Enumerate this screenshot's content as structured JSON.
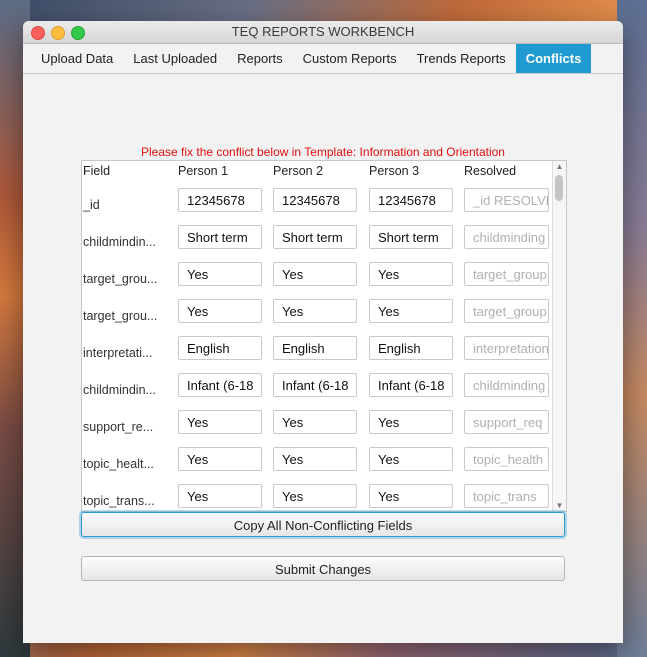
{
  "window": {
    "title": "TEQ REPORTS WORKBENCH"
  },
  "tabs": [
    {
      "label": "Upload Data"
    },
    {
      "label": "Last Uploaded"
    },
    {
      "label": "Reports"
    },
    {
      "label": "Custom Reports"
    },
    {
      "label": "Trends Reports"
    },
    {
      "label": "Conflicts"
    }
  ],
  "message": "Please fix the conflict below in Template: Information and Orientation",
  "grid": {
    "headers": [
      "Field",
      "Person 1",
      "Person 2",
      "Person 3",
      "Resolved"
    ],
    "rows": [
      {
        "field": "_id",
        "p1": "12345678",
        "p2": "12345678",
        "p3": "12345678",
        "resolved": "_id RESOLVED"
      },
      {
        "field": "childmindin...",
        "p1": "Short term",
        "p2": "Short term",
        "p3": "Short term",
        "resolved": "childminding"
      },
      {
        "field": "target_grou...",
        "p1": "Yes",
        "p2": "Yes",
        "p3": "Yes",
        "resolved": "target_group"
      },
      {
        "field": "target_grou...",
        "p1": "Yes",
        "p2": "Yes",
        "p3": "Yes",
        "resolved": "target_group"
      },
      {
        "field": "interpretati...",
        "p1": "English",
        "p2": "English",
        "p3": "English",
        "resolved": "interpretation"
      },
      {
        "field": "childmindin...",
        "p1": "Infant (6-18",
        "p2": "Infant (6-18",
        "p3": "Infant (6-18",
        "resolved": "childminding"
      },
      {
        "field": "support_re...",
        "p1": "Yes",
        "p2": "Yes",
        "p3": "Yes",
        "resolved": "support_req"
      },
      {
        "field": "topic_healt...",
        "p1": "Yes",
        "p2": "Yes",
        "p3": "Yes",
        "resolved": "topic_health"
      },
      {
        "field": "topic_trans...",
        "p1": "Yes",
        "p2": "Yes",
        "p3": "Yes",
        "resolved": "topic_trans"
      }
    ]
  },
  "buttons": {
    "copy": "Copy All Non-Conflicting Fields",
    "submit": "Submit Changes"
  }
}
